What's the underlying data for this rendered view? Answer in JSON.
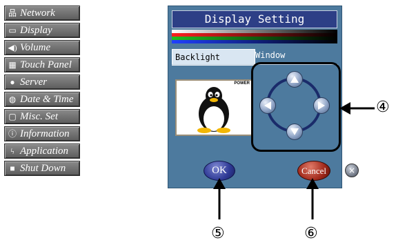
{
  "sidebar": {
    "items": [
      {
        "label": "Network",
        "icon": "network-icon",
        "glyph": "品"
      },
      {
        "label": "Display",
        "icon": "display-icon",
        "glyph": "▭"
      },
      {
        "label": "Volume",
        "icon": "speaker-icon",
        "glyph": "◀)"
      },
      {
        "label": "Touch Panel",
        "icon": "touch-panel-icon",
        "glyph": "▦"
      },
      {
        "label": "Server",
        "icon": "server-icon",
        "glyph": "●"
      },
      {
        "label": "Date & Time",
        "icon": "globe-clock-icon",
        "glyph": "◍"
      },
      {
        "label": "Misc. Set",
        "icon": "misc-icon",
        "glyph": "▢"
      },
      {
        "label": "Information",
        "icon": "info-icon",
        "glyph": "ⓘ"
      },
      {
        "label": "Application",
        "icon": "lightning-icon",
        "glyph": "ϟ"
      },
      {
        "label": "Shut Down",
        "icon": "shutdown-icon",
        "glyph": "■"
      }
    ]
  },
  "panel": {
    "title": "Display Setting",
    "tabs": {
      "backlight": "Backlight",
      "window": "Window"
    },
    "preview_badge": "POWER",
    "ok_label": "OK",
    "cancel_label": "Cancel",
    "close_glyph": "×"
  },
  "callouts": {
    "four": "④",
    "five": "⑤",
    "six": "⑥"
  },
  "colors": {
    "panel_bg": "#4d7a9e",
    "title_bg": "#2d3f86",
    "sidebar_bg": "#6e6e6e",
    "ok": "#2f3a96",
    "cancel": "#a0281a"
  }
}
